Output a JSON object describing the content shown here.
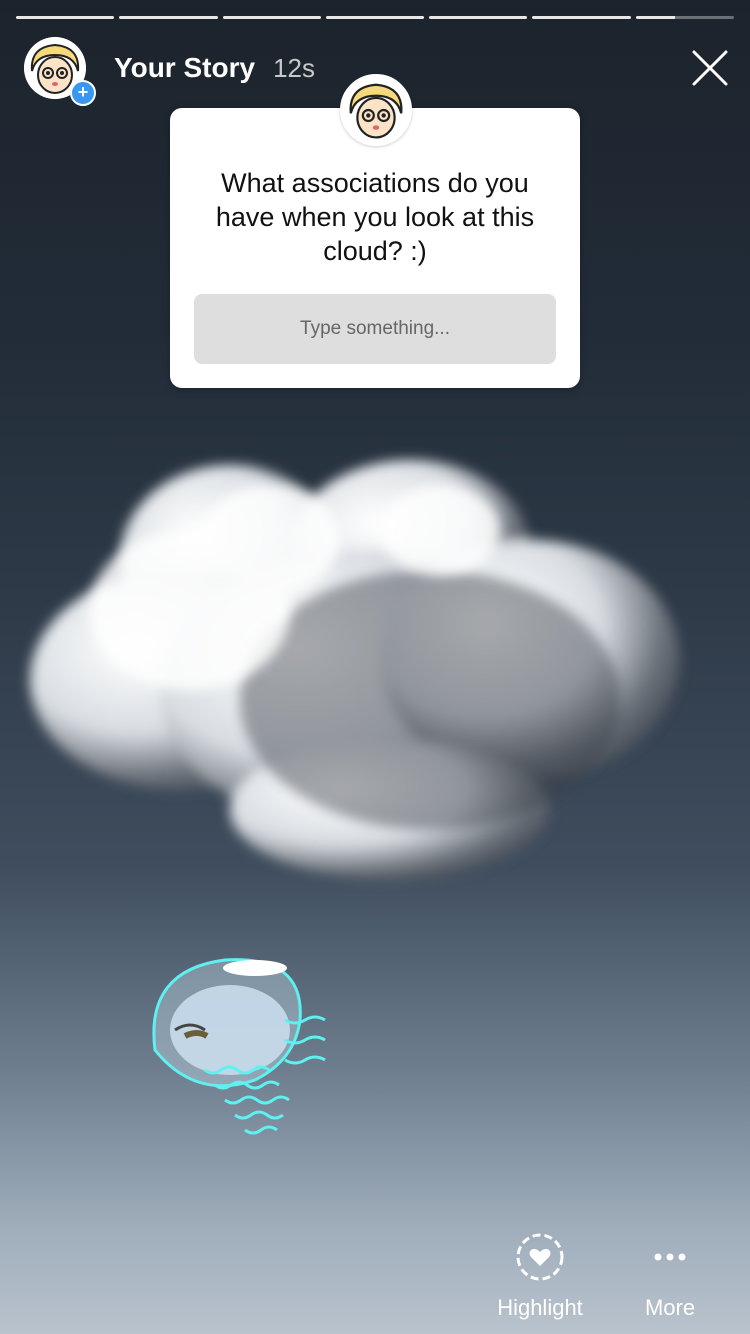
{
  "header": {
    "title": "Your Story",
    "time": "12s"
  },
  "progress": {
    "segment_count": 7,
    "current_segment_fill": 0.4
  },
  "question_card": {
    "question": "What associations do you have when you look at this cloud? :)",
    "input_placeholder": "Type something..."
  },
  "footer": {
    "highlight_label": "Highlight",
    "more_label": "More"
  },
  "colors": {
    "accent_blue": "#3897f0",
    "jelly_outline": "#5ff0f0"
  },
  "icons": [
    "avatar-icon",
    "plus-icon",
    "close-icon",
    "heart-icon",
    "more-dots-icon",
    "cloud-sticker",
    "jellyfish-sticker"
  ]
}
